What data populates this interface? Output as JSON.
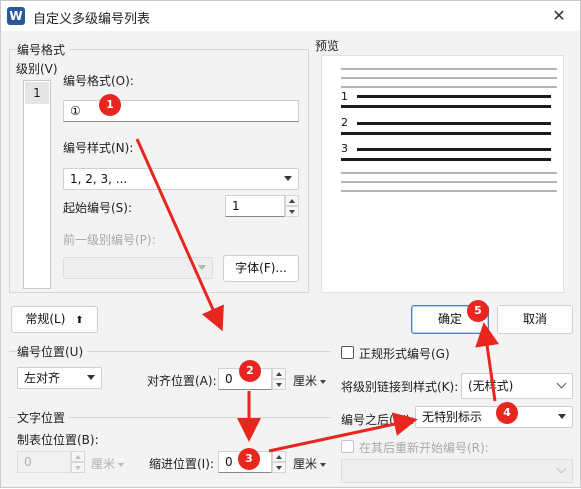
{
  "window": {
    "title": "自定义多级编号列表",
    "app_icon_letter": "W"
  },
  "number_format": {
    "group_title": "编号格式",
    "level_label": "级别(V)",
    "levels": [
      "1"
    ],
    "format_label": "编号格式(O):",
    "format_value": "①",
    "style_label": "编号样式(N):",
    "style_value": "1, 2, 3, ...",
    "start_label": "起始编号(S):",
    "start_value": "1",
    "prev_level_label": "前一级别编号(P):",
    "font_button": "字体(F)..."
  },
  "preview": {
    "title": "预览",
    "numbers": [
      "1",
      "2",
      "3"
    ]
  },
  "toggle_button": "常规(L)",
  "toggle_arrow": "⬆",
  "position": {
    "group_title": "编号位置(U)",
    "align_value": "左对齐",
    "align_pos_label": "对齐位置(A):",
    "align_pos_value": "0",
    "unit": "厘米"
  },
  "text_position": {
    "group_title": "文字位置",
    "tab_label": "制表位位置(B):",
    "tab_value": "0",
    "tab_unit": "厘米",
    "indent_label": "缩进位置(I):",
    "indent_value": "0",
    "indent_unit": "厘米"
  },
  "buttons": {
    "ok": "确定",
    "cancel": "取消"
  },
  "options": {
    "legal_label": "正规形式编号(G)",
    "link_label": "将级别链接到样式(K):",
    "link_value": "(无样式)",
    "follow_label": "编号之后(W):",
    "follow_value": "无特别标示",
    "restart_label": "在其后重新开始编号(R):"
  },
  "annotations": [
    "1",
    "2",
    "3",
    "4",
    "5"
  ],
  "colors": {
    "annotation": "#e8251f",
    "accent": "#4a7fc1"
  }
}
